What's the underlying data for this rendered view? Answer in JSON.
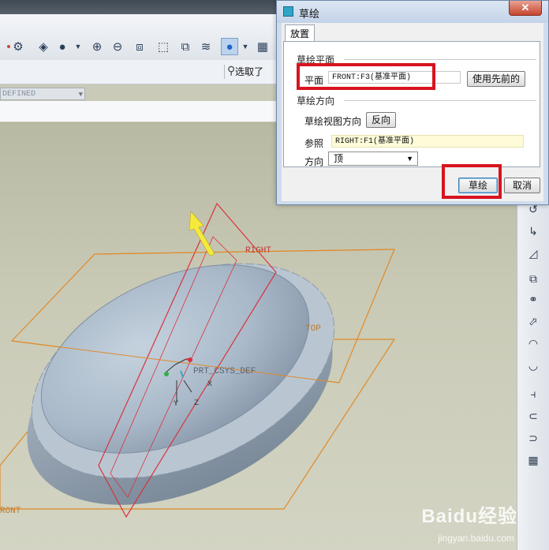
{
  "dialog": {
    "title": "草绘",
    "close_glyph": "✕",
    "tab_label": "放置",
    "section_plane_title": "草绘平面",
    "plane_label": "平面",
    "plane_value": "FRONT:F3(基准平面)",
    "use_previous_label": "使用先前的",
    "section_orientation_title": "草绘方向",
    "view_direction_label": "草绘视图方向",
    "flip_label": "反向",
    "reference_label": "参照",
    "reference_value": "RIGHT:F1(基准平面)",
    "orientation_label": "方向",
    "orientation_value": "顶",
    "sketch_button_label": "草绘",
    "cancel_button_label": "取消"
  },
  "toolbar": {
    "defined_combo_value": "DEFINED",
    "select_label": "选取了"
  },
  "viewport": {
    "datum_right_label": "RIGHT",
    "datum_top_label": "TOP",
    "datum_front_label": "RONT",
    "csys_label": "PRT_CSYS_DEF",
    "axis_x": "X",
    "axis_y": "Y",
    "axis_z": "Z"
  },
  "watermark": {
    "brand": "Baidu经验",
    "url": "jingyan.baidu.com"
  },
  "colors": {
    "highlight_red": "#d7141e",
    "datum_orange": "#e08a2a",
    "datum_red": "#d8323c",
    "part_grey": "#9eafc0"
  }
}
